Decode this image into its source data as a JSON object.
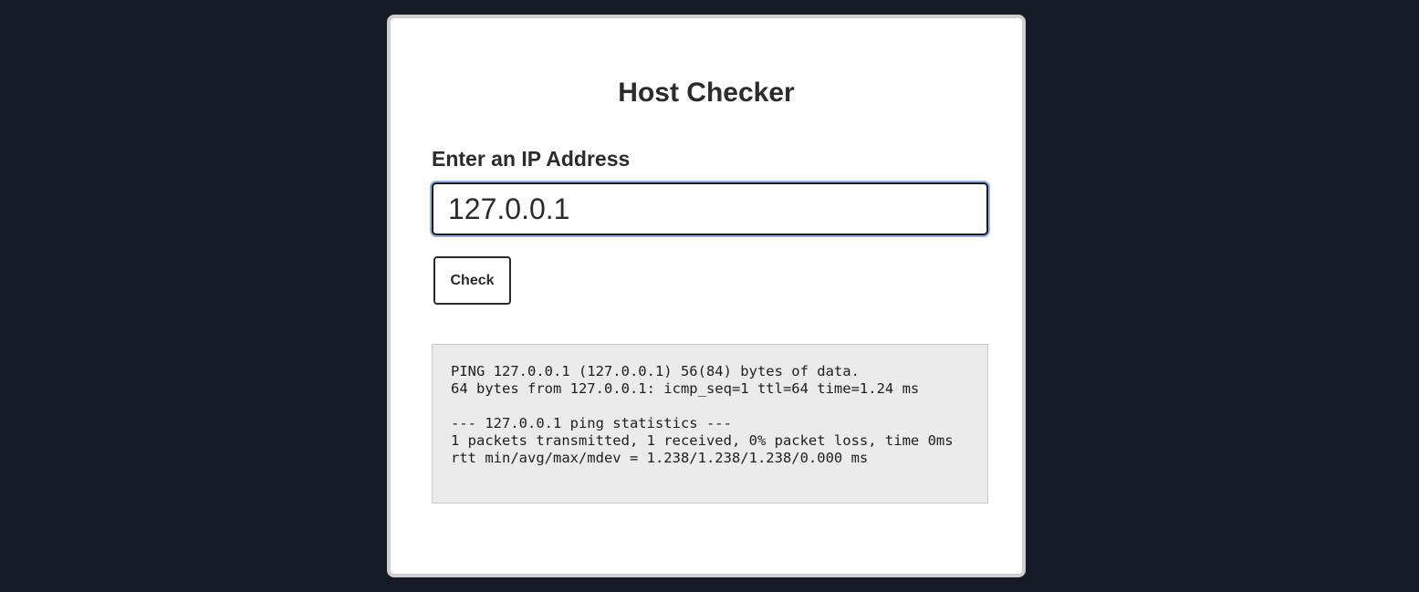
{
  "page": {
    "title": "Host Checker"
  },
  "form": {
    "label": "Enter an IP Address",
    "ip_value": "127.0.0.1",
    "check_label": "Check"
  },
  "output": {
    "text": "PING 127.0.0.1 (127.0.0.1) 56(84) bytes of data.\n64 bytes from 127.0.0.1: icmp_seq=1 ttl=64 time=1.24 ms\n\n--- 127.0.0.1 ping statistics ---\n1 packets transmitted, 1 received, 0% packet loss, time 0ms\nrtt min/avg/max/mdev = 1.238/1.238/1.238/0.000 ms"
  },
  "colors": {
    "background": "#151b26",
    "card": "#ffffff",
    "card_border": "#cfcfcf",
    "focus_ring": "#8fb3e8",
    "output_background": "#ebebeb"
  }
}
